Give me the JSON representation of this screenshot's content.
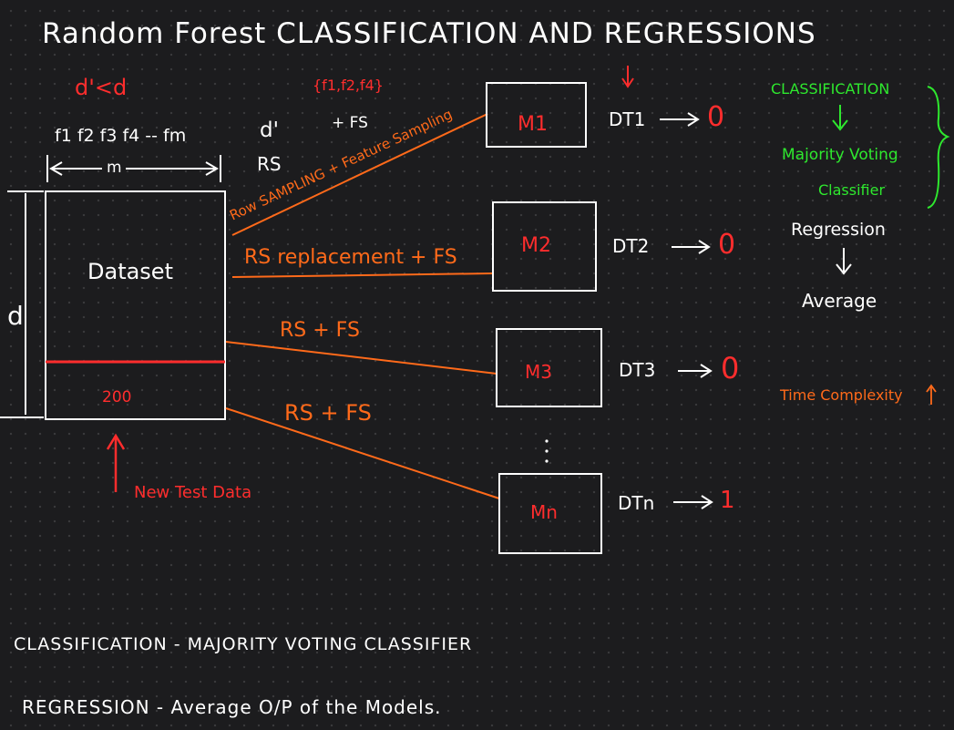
{
  "title": "Random Forest CLASSIFICATION AND REGRESSIONS",
  "colors": {
    "background": "#1c1c1e",
    "white": "#ffffff",
    "red": "#ff2d2d",
    "orange": "#ff6a1a",
    "green": "#2ee82e"
  },
  "dataset": {
    "d_prime_note": "d'<d",
    "features": "f1 f2 f3 f4 -- fm",
    "m_label": "m",
    "d_label": "d",
    "name": "Dataset",
    "test_value": "200",
    "new_test_data": "New Test Data"
  },
  "sampling": {
    "feature_set": "{f1,f2,f4}",
    "d_prime": "d'",
    "rs": "RS",
    "plus_fs": "+ FS",
    "row_sampling": "Row SAMPLING + Feature Sampling",
    "line2": "RS replacement + FS",
    "line3": "RS + FS",
    "line4": "RS + FS"
  },
  "models": [
    {
      "label": "M1",
      "tree": "DT1",
      "output": "0"
    },
    {
      "label": "M2",
      "tree": "DT2",
      "output": "0"
    },
    {
      "label": "M3",
      "tree": "DT3",
      "output": "0"
    },
    {
      "label": "Mn",
      "tree": "DTn",
      "output": "1"
    }
  ],
  "right_panel": {
    "classification": "CLASSIFICATION",
    "majority_voting": "Majority Voting",
    "classifier": "Classifier",
    "regression": "Regression",
    "average": "Average",
    "time_complexity": "Time Complexity"
  },
  "summary": {
    "classification": "CLASSIFICATION - MAJORITY VOTING CLASSIFIER",
    "regression": "REGRESSION - Average O/P of the Models."
  }
}
